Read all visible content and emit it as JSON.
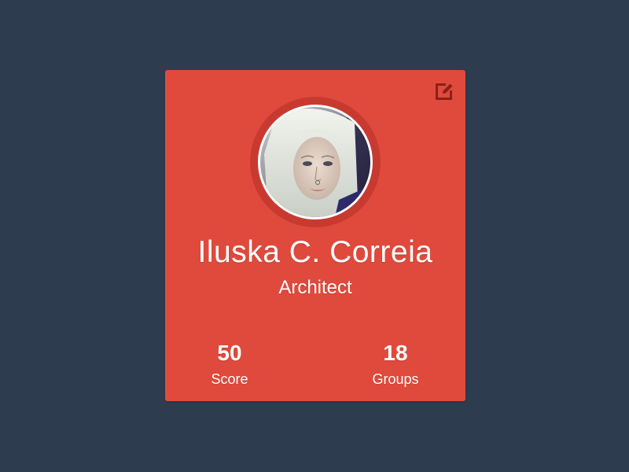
{
  "profile": {
    "name": "Iluska C. Correia",
    "role": "Architect"
  },
  "stats": [
    {
      "value": "50",
      "label": "Score"
    },
    {
      "value": "18",
      "label": "Groups"
    }
  ],
  "icons": {
    "edit": "edit-icon",
    "avatar": "avatar-photo"
  },
  "colors": {
    "background": "#2e3c50",
    "card": "#df4a3c",
    "ring": "#c83a30",
    "icon": "#8e1f18"
  }
}
